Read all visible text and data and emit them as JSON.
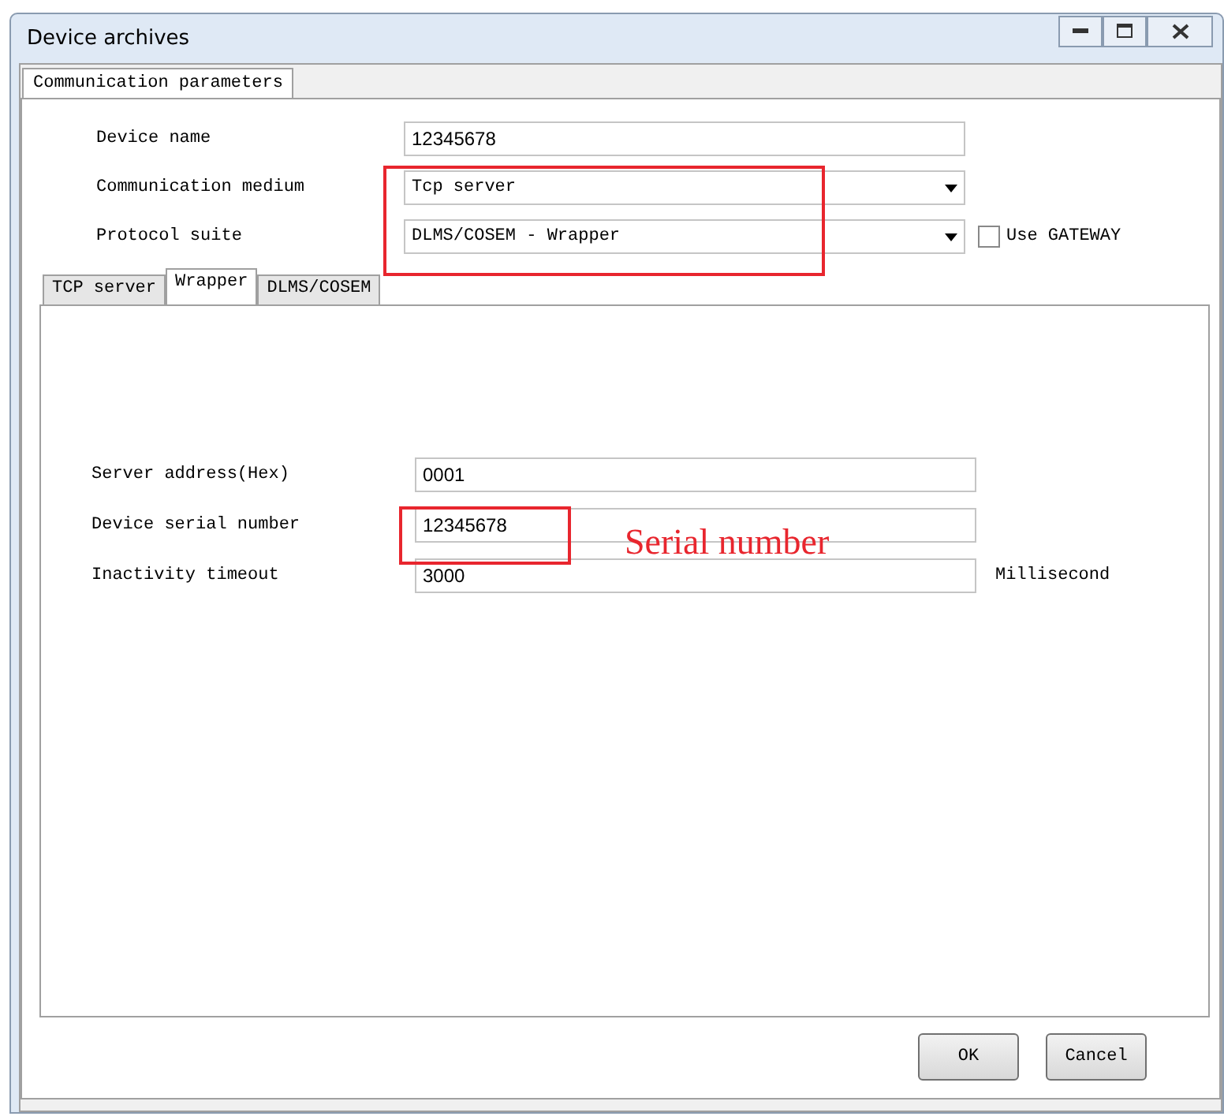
{
  "window": {
    "title": "Device archives"
  },
  "outer_tabs": [
    {
      "label": "Communication parameters",
      "selected": true
    }
  ],
  "fields": [
    {
      "label": "Device name",
      "kind": "text",
      "value": "12345678"
    },
    {
      "label": "Communication medium",
      "kind": "dropdown",
      "value": "Tcp server"
    },
    {
      "label": "Protocol suite",
      "kind": "dropdown",
      "value": "DLMS/COSEM - Wrapper"
    }
  ],
  "gateway": {
    "label": "Use GATEWAY",
    "checked": false
  },
  "inner_tabs": [
    {
      "label": "TCP server",
      "selected": false
    },
    {
      "label": "Wrapper",
      "selected": true
    },
    {
      "label": "DLMS/COSEM",
      "selected": false
    }
  ],
  "wrapper_fields": [
    {
      "label": "Server address(Hex)",
      "value": "0001"
    },
    {
      "label": "Device serial number",
      "value": "12345678"
    },
    {
      "label": "Inactivity timeout",
      "value": "3000",
      "unit": "Millisecond"
    }
  ],
  "annotation": {
    "text": "Serial number"
  },
  "buttons": [
    "OK",
    "Cancel"
  ]
}
